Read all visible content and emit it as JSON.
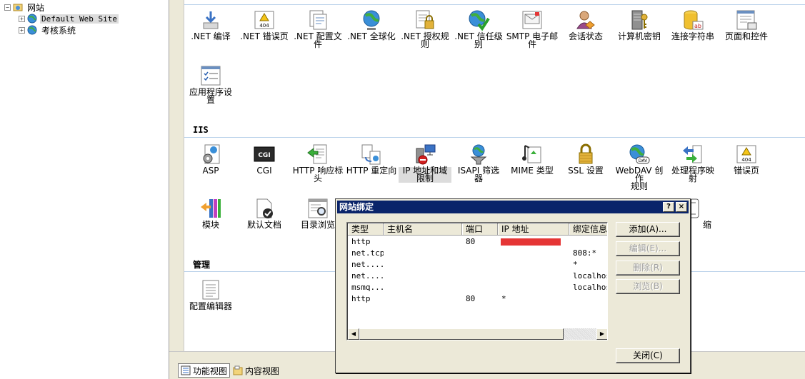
{
  "tree": {
    "root_label": "网站",
    "items": [
      {
        "label": "Default Web Site",
        "selected": true
      },
      {
        "label": "考核系统",
        "selected": false
      }
    ]
  },
  "groups": {
    "aspnet_features": [
      {
        "label1": ".NET 编译",
        "label2": "",
        "icon": "compile-icon"
      },
      {
        "label1": ".NET 错误页",
        "label2": "",
        "icon": "error-404-icon"
      },
      {
        "label1": ".NET 配置文",
        "label2": "件",
        "icon": "profile-icon"
      },
      {
        "label1": ".NET 全球化",
        "label2": "",
        "icon": "globe-icon"
      },
      {
        "label1": ".NET 授权规",
        "label2": "则",
        "icon": "lock-doc-icon"
      },
      {
        "label1": ".NET 信任级",
        "label2": "别",
        "icon": "globe-check-icon"
      },
      {
        "label1": "SMTP 电子邮",
        "label2": "件",
        "icon": "mail-icon"
      },
      {
        "label1": "会话状态",
        "label2": "",
        "icon": "session-user-icon"
      },
      {
        "label1": "计算机密钥",
        "label2": "",
        "icon": "server-key-icon"
      },
      {
        "label1": "连接字符串",
        "label2": "",
        "icon": "database-icon"
      },
      {
        "label1": "页面和控件",
        "label2": "",
        "icon": "page-controls-icon"
      },
      {
        "label1": "应用程序设",
        "label2": "置",
        "icon": "app-settings-icon"
      }
    ],
    "iis_title": "IIS",
    "iis_features": [
      {
        "label1": "ASP",
        "label2": "",
        "icon": "asp-icon"
      },
      {
        "label1": "CGI",
        "label2": "",
        "icon": "cgi-icon"
      },
      {
        "label1": "HTTP 响应标",
        "label2": "头",
        "icon": "http-headers-icon"
      },
      {
        "label1": "HTTP 重定向",
        "label2": "",
        "icon": "redirect-icon"
      },
      {
        "label1": "IP 地址和域",
        "label2": "限制",
        "icon": "ip-restrict-icon"
      },
      {
        "label1": "ISAPI 筛选",
        "label2": "器",
        "icon": "filter-icon"
      },
      {
        "label1": "MIME 类型",
        "label2": "",
        "icon": "mime-icon"
      },
      {
        "label1": "SSL 设置",
        "label2": "",
        "icon": "padlock-icon"
      },
      {
        "label1": "WebDAV 创作",
        "label2": "规则",
        "icon": "webdav-icon"
      },
      {
        "label1": "处理程序映",
        "label2": "射",
        "icon": "handler-icon"
      },
      {
        "label1": "错误页",
        "label2": "",
        "icon": "error-page-icon"
      },
      {
        "label1": "模块",
        "label2": "",
        "icon": "modules-icon"
      },
      {
        "label1": "默认文档",
        "label2": "",
        "icon": "default-doc-icon"
      },
      {
        "label1": "目录浏览",
        "label2": "",
        "icon": "dir-browse-icon"
      },
      {
        "label1": "缩",
        "label2": "",
        "icon": "compression-icon"
      }
    ],
    "manage_title": "管理",
    "manage_features": [
      {
        "label1": "配置编辑器",
        "label2": "",
        "icon": "config-editor-icon"
      }
    ]
  },
  "bottom_tabs": {
    "features_view": "功能视图",
    "content_view": "内容视图"
  },
  "dialog": {
    "title": "网站绑定",
    "help_label": "?",
    "close_x_label": "×",
    "columns": [
      "类型",
      "主机名",
      "端口",
      "IP 地址",
      "绑定信息"
    ],
    "rows": [
      {
        "type": "http",
        "host": "",
        "port": "80",
        "ip": "",
        "ip_redacted": true,
        "binding": ""
      },
      {
        "type": "net.tcp",
        "host": "",
        "port": "",
        "ip": "",
        "ip_redacted": false,
        "binding": "808:*"
      },
      {
        "type": "net....",
        "host": "",
        "port": "",
        "ip": "",
        "ip_redacted": false,
        "binding": "*"
      },
      {
        "type": "net....",
        "host": "",
        "port": "",
        "ip": "",
        "ip_redacted": false,
        "binding": "localhos"
      },
      {
        "type": "msmq...",
        "host": "",
        "port": "",
        "ip": "",
        "ip_redacted": false,
        "binding": "localhos"
      },
      {
        "type": "http",
        "host": "",
        "port": "80",
        "ip": "*",
        "ip_redacted": false,
        "binding": ""
      }
    ],
    "buttons": {
      "add": "添加(A)...",
      "edit": "编辑(E)...",
      "remove": "删除(R)",
      "browse": "浏览(B)",
      "close": "关闭(C)"
    }
  },
  "colors": {
    "title_bar": "#0a246a",
    "redaction": "#e53535",
    "group_line": "#b9d1ea"
  }
}
